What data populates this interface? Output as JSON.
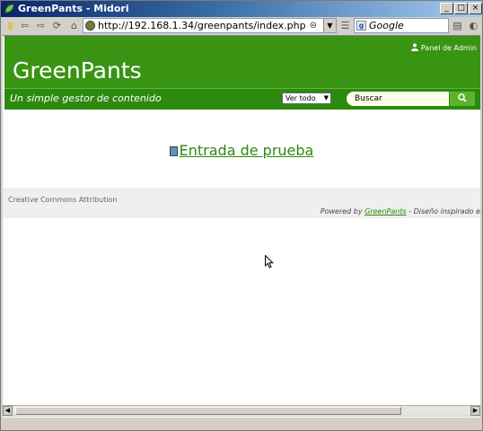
{
  "window": {
    "title": "GreenPants - Midori"
  },
  "browser": {
    "url": "http://192.168.1.34/greenpants/index.php",
    "search_engine": "Google"
  },
  "site": {
    "admin_link": "Panel de Admin",
    "title": "GreenPants",
    "tagline": "Un simple gestor de contenido",
    "view_select": "Ver todo",
    "search_placeholder": "Buscar",
    "post_title": "Entrada de prueba",
    "license": "Creative Commons Attribution",
    "powered_prefix": "Powered by ",
    "powered_link": "GreenPants",
    "powered_suffix": " - Diseño inspirado e"
  },
  "colors": {
    "header_green": "#3a9414",
    "link_green": "#2c8a0f"
  }
}
